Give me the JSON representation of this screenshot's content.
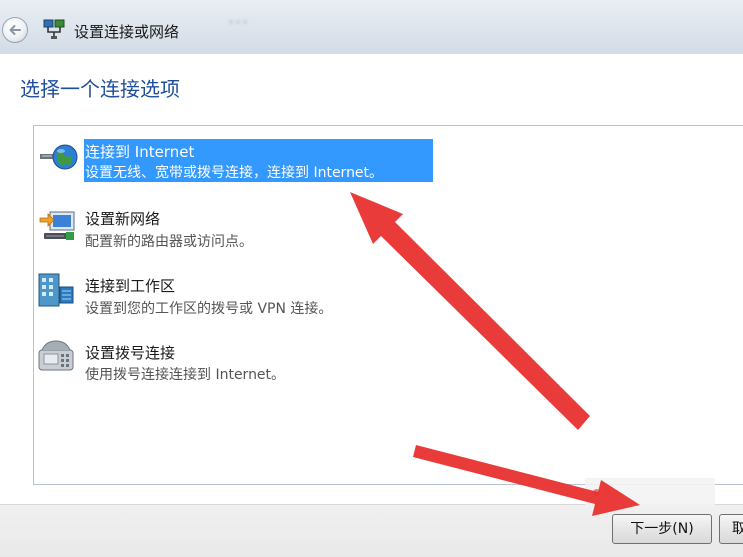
{
  "window": {
    "title": "设置连接或网络",
    "blurred_header_text": "..."
  },
  "page": {
    "heading": "选择一个连接选项"
  },
  "options": [
    {
      "title": "连接到 Internet",
      "desc": "设置无线、宽带或拨号连接，连接到 Internet。",
      "icon": "globe-network-icon",
      "selected": true
    },
    {
      "title": "设置新网络",
      "desc": "配置新的路由器或访问点。",
      "icon": "router-setup-icon",
      "selected": false
    },
    {
      "title": "连接到工作区",
      "desc": "设置到您的工作区的拨号或 VPN 连接。",
      "icon": "workplace-building-icon",
      "selected": false
    },
    {
      "title": "设置拨号连接",
      "desc": "使用拨号连接连接到 Internet。",
      "icon": "dialup-phone-icon",
      "selected": false
    }
  ],
  "buttons": {
    "next": "下一步(N)",
    "cancel": "取"
  },
  "colors": {
    "selection": "#3399ff",
    "heading": "#1f4e9c",
    "annotation_arrow": "#e8312f"
  }
}
